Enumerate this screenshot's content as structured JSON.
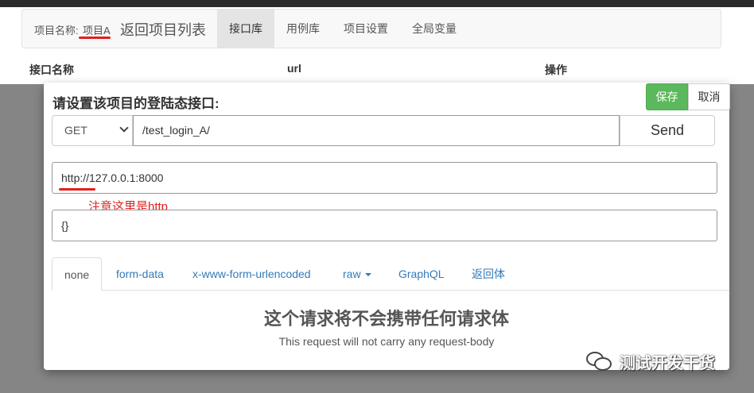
{
  "nav": {
    "project_label": "项目名称:",
    "project_name": "项目A",
    "back_link": "返回项目列表",
    "tabs": [
      "接口库",
      "用例库",
      "项目设置",
      "全局变量"
    ]
  },
  "table": {
    "columns": [
      "接口名称",
      "url",
      "操作"
    ]
  },
  "modal": {
    "title": "请设置该项目的登陆态接口:",
    "save_label": "保存",
    "cancel_label": "取消",
    "method": "GET",
    "url_value": "/test_login_A/",
    "send_label": "Send",
    "host_value": "http://127.0.0.1:8000",
    "note": "注意这里是http",
    "body_value": "{}",
    "body_tabs": [
      "none",
      "form-data",
      "x-www-form-urlencoded",
      "raw",
      "GraphQL",
      "返回体"
    ],
    "empty_title": "这个请求将不会携带任何请求体",
    "empty_subtitle": "This request will not carry any request-body"
  },
  "watermark": "测试开发干货",
  "colors": {
    "save": "#5cb85c",
    "annotation": "#e0201c",
    "link": "#337ab7"
  }
}
